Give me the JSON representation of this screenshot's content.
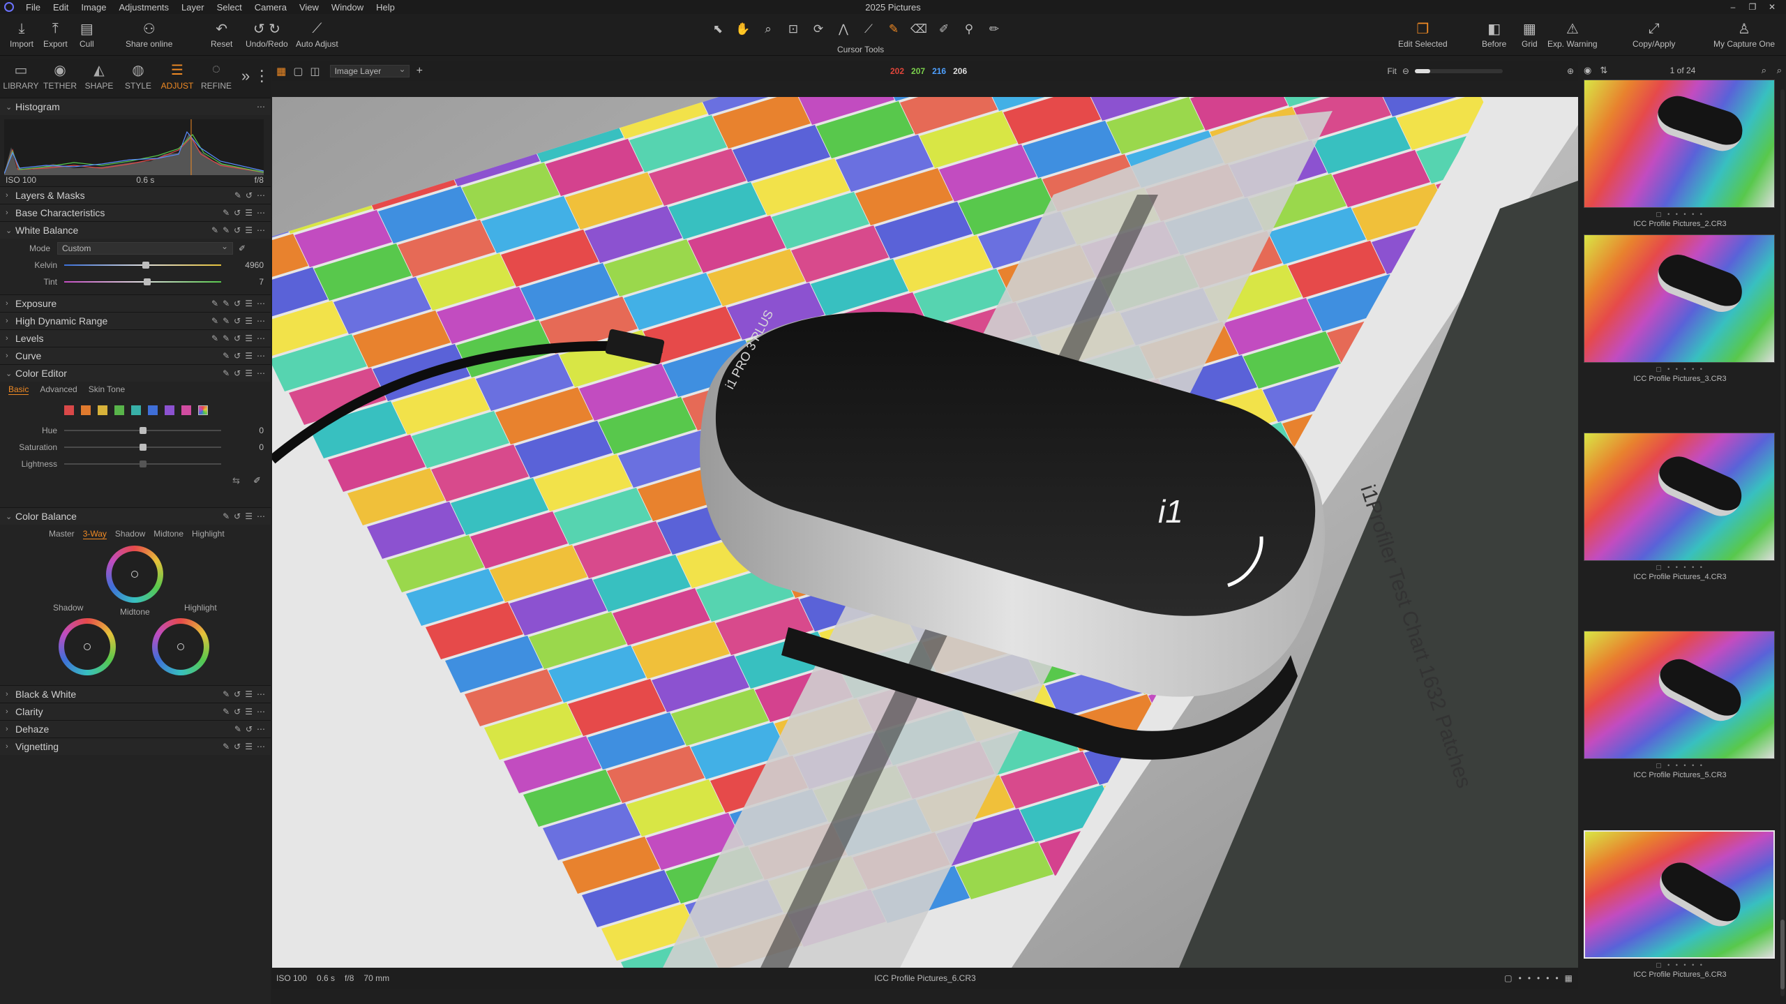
{
  "app": {
    "title": "2025 Pictures",
    "menu": [
      "File",
      "Edit",
      "Image",
      "Adjustments",
      "Layer",
      "Select",
      "Camera",
      "View",
      "Window",
      "Help"
    ]
  },
  "toolbar": {
    "import": "Import",
    "export": "Export",
    "cull": "Cull",
    "share": "Share online",
    "reset": "Reset",
    "undo_redo": "Undo/Redo",
    "auto_adjust": "Auto Adjust",
    "cursor_tools": "Cursor Tools",
    "edit_selected": "Edit Selected",
    "before": "Before",
    "grid": "Grid",
    "exp_warning": "Exp. Warning",
    "copy_apply": "Copy/Apply",
    "my_capture_one": "My Capture One"
  },
  "tooltabs": [
    "LIBRARY",
    "TETHER",
    "SHAPE",
    "STYLE",
    "ADJUST",
    "REFINE"
  ],
  "active_tab": "ADJUST",
  "histogram": {
    "title": "Histogram",
    "iso": "ISO 100",
    "shutter": "0.6 s",
    "aperture": "f/8"
  },
  "sections": {
    "layers": "Layers & Masks",
    "base": "Base Characteristics",
    "wb": "White Balance",
    "exposure": "Exposure",
    "hdr": "High Dynamic Range",
    "levels": "Levels",
    "curve": "Curve",
    "color_editor": "Color Editor",
    "color_balance": "Color Balance",
    "bw": "Black & White",
    "clarity": "Clarity",
    "dehaze": "Dehaze",
    "vignetting": "Vignetting"
  },
  "white_balance": {
    "mode_label": "Mode",
    "mode_value": "Custom",
    "kelvin_label": "Kelvin",
    "kelvin_value": "4960",
    "kelvin_level": 0.52,
    "tint_label": "Tint",
    "tint_value": "7",
    "tint_level": 0.53
  },
  "color_editor": {
    "tabs": [
      "Basic",
      "Advanced",
      "Skin Tone"
    ],
    "active": "Basic",
    "swatches": [
      "#d94848",
      "#e07a2e",
      "#d7b23a",
      "#58b44a",
      "#38b0a8",
      "#3f6fd8",
      "#8c52d0",
      "#d04ca0"
    ],
    "hue_label": "Hue",
    "hue_value": "0",
    "sat_label": "Saturation",
    "sat_value": "0",
    "light_label": "Lightness"
  },
  "color_balance": {
    "tabs": [
      "Master",
      "3-Way",
      "Shadow",
      "Midtone",
      "Highlight"
    ],
    "active": "3-Way",
    "midtone": "Midtone",
    "shadow": "Shadow",
    "highlight": "Highlight"
  },
  "viewer": {
    "layer": "Image Layer",
    "r": "202",
    "g": "207",
    "b": "216",
    "l": "206",
    "fit": "Fit",
    "rgb_colors": {
      "r": "#e0453a",
      "g": "#7bd04c",
      "b": "#4ea0ff",
      "l": "#dddddd"
    }
  },
  "footer": {
    "iso": "ISO 100",
    "shutter": "0.6 s",
    "aperture": "f/8",
    "focal": "70 mm",
    "filename": "ICC Profile Pictures_6.CR3"
  },
  "browser": {
    "count": "1 of 24",
    "thumbs": [
      {
        "name": "ICC Profile Pictures_2.CR3"
      },
      {
        "name": "ICC Profile Pictures_3.CR3"
      },
      {
        "name": "ICC Profile Pictures_4.CR3"
      },
      {
        "name": "ICC Profile Pictures_5.CR3"
      },
      {
        "name": "ICC Profile Pictures_6.CR3",
        "selected": true
      }
    ]
  },
  "device_text": {
    "brand": "i1 PRO 3 PLUS",
    "chart_text": "i1Profiler Test Chart 1632 Patches"
  }
}
